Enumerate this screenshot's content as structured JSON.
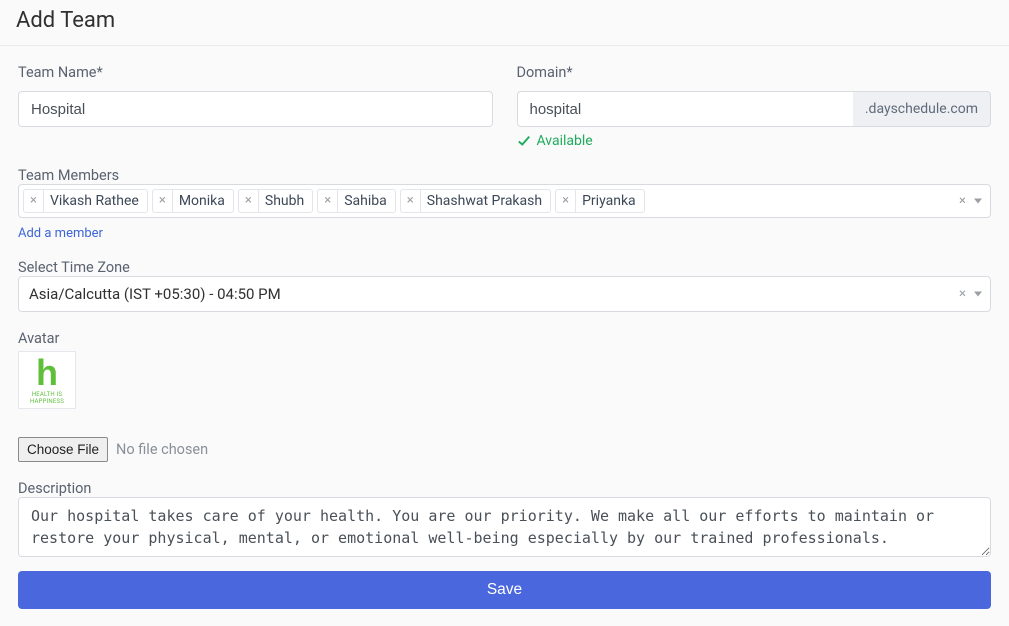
{
  "header": {
    "title": "Add Team"
  },
  "team_name": {
    "label": "Team Name*",
    "value": "Hospital"
  },
  "domain": {
    "label": "Domain*",
    "value": "hospital",
    "suffix": ".dayschedule.com",
    "status": "Available"
  },
  "members": {
    "label": "Team Members",
    "tags": [
      "Vikash Rathee",
      "Monika",
      "Shubh",
      "Sahiba",
      "Shashwat Prakash",
      "Priyanka"
    ],
    "add_link": "Add a member"
  },
  "timezone": {
    "label": "Select Time Zone",
    "value": "Asia/Calcutta  (IST +05:30)   -   04:50 PM"
  },
  "avatar": {
    "label": "Avatar",
    "caption": "HEALTH IS HAPPINESS",
    "choose_file": "Choose File",
    "file_status": "No file chosen"
  },
  "description": {
    "label": "Description",
    "value": "Our hospital takes care of your health. You are our priority. We make all our efforts to maintain or restore your physical, mental, or emotional well-being especially by our trained professionals."
  },
  "actions": {
    "save": "Save"
  }
}
